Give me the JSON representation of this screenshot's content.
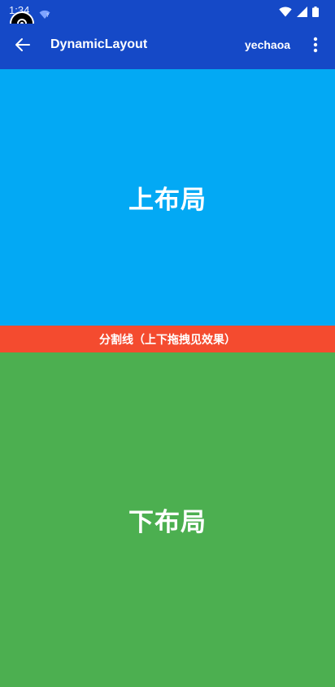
{
  "status_bar": {
    "time": "1:34",
    "icons": [
      "wifi-icon",
      "signal-icon",
      "battery-icon"
    ],
    "notification_icon": "wifi-question-icon"
  },
  "app_bar": {
    "back_icon": "arrow-back-icon",
    "title": "DynamicLayout",
    "action_label": "yechaoa",
    "overflow_icon": "more-vert-icon",
    "color": "#1549C7"
  },
  "layout": {
    "top_label": "上布局",
    "top_color": "#03A9F4",
    "divider_label": "分割线（上下拖拽见效果）",
    "divider_color": "#F44B2F",
    "bottom_label": "下布局",
    "bottom_color": "#4CAF50"
  }
}
